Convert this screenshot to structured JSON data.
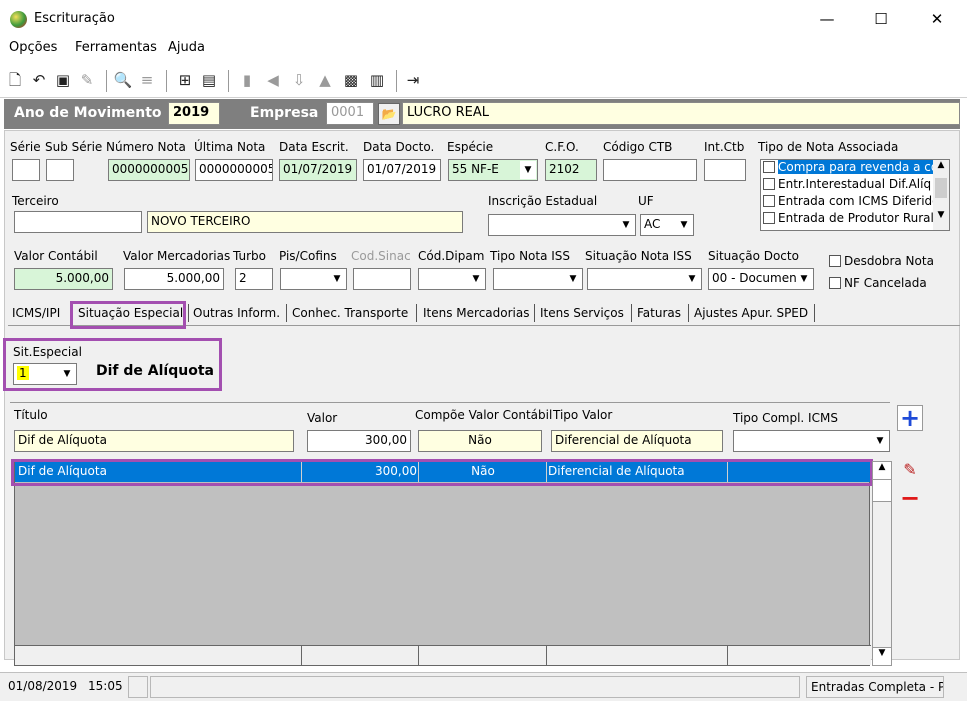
{
  "window": {
    "title": "Escrituração",
    "minimize": "—",
    "maximize": "☐",
    "close": "✕"
  },
  "menu": [
    "Opções",
    "Ferramentas",
    "Ajuda"
  ],
  "header": {
    "ano_label": "Ano de Movimento",
    "ano_value": "2019",
    "empresa_label": "Empresa",
    "empresa_code": "0001",
    "empresa_name": "LUCRO REAL"
  },
  "labels": {
    "serie": "Série",
    "sub_serie": "Sub Série",
    "numero_nota": "Número Nota",
    "ultima_nota": "Última Nota",
    "data_escrit": "Data Escrit.",
    "data_docto": "Data Docto.",
    "especie": "Espécie",
    "cfo": "C.F.O.",
    "codigo_ctb": "Código CTB",
    "int_ctb": "Int.Ctb",
    "tipo_nota_associada": "Tipo de Nota Associada",
    "terceiro": "Terceiro",
    "inscricao_estadual": "Inscrição Estadual",
    "uf": "UF",
    "valor_contabil": "Valor Contábil",
    "valor_mercadorias": "Valor Mercadorias",
    "turbo": "Turbo",
    "pis_cofins": "Pis/Cofins",
    "cod_sinac": "Cod.Sinac",
    "cod_dipam": "Cód.Dipam",
    "tipo_nota_iss": "Tipo Nota ISS",
    "situacao_nota_iss": "Situação Nota ISS",
    "situacao_docto": "Situação Docto",
    "desdobra_nota": "Desdobra Nota",
    "nf_cancelada": "NF Cancelada"
  },
  "values": {
    "serie": "",
    "sub_serie": "",
    "numero_nota": "0000000005",
    "ultima_nota": "0000000005",
    "data_escrit": "01/07/2019",
    "data_docto": "01/07/2019",
    "especie": "55 NF-E",
    "cfo": "2102",
    "codigo_ctb": "",
    "int_ctb": "",
    "terceiro_code": "",
    "terceiro_name": "NOVO TERCEIRO",
    "inscricao_estadual": "",
    "uf": "AC",
    "valor_contabil": "5.000,00",
    "valor_mercadorias": "5.000,00",
    "turbo": "2",
    "situacao_docto": "00 - Documen"
  },
  "tipo_nota_options": [
    {
      "label": "Compra para revenda a co",
      "selected": true
    },
    {
      "label": "Entr.Interestadual Dif.Alíq",
      "selected": false
    },
    {
      "label": "Entrada com ICMS Diferido",
      "selected": false
    },
    {
      "label": "Entrada de Produtor Rural",
      "selected": false
    }
  ],
  "tabs": [
    "ICMS/IPI",
    "Situação Especial",
    "Outras Inform.",
    "Conhec. Transporte",
    "Itens Mercadorias",
    "Itens Serviços",
    "Faturas",
    "Ajustes Apur. SPED"
  ],
  "active_tab": "Situação Especial",
  "sit_especial": {
    "label": "Sit.Especial",
    "value": "1",
    "description": "Dif de Alíquota"
  },
  "item_form": {
    "labels": {
      "titulo": "Título",
      "valor": "Valor",
      "compoe": "Compõe Valor Contábil",
      "tipo_valor": "Tipo Valor",
      "tipo_compl": "Tipo Compl. ICMS"
    },
    "values": {
      "titulo": "Dif de Alíquota",
      "valor": "300,00",
      "compoe": "Não",
      "tipo_valor": "Diferencial de Alíquota",
      "tipo_compl": ""
    }
  },
  "grid_rows": [
    {
      "titulo": "Dif de Alíquota",
      "valor": "300,00",
      "compoe": "Não",
      "tipo_valor": "Diferencial de Alíquota",
      "tipo_compl": ""
    }
  ],
  "status": {
    "date": "01/08/2019",
    "time": "15:05",
    "p3": "",
    "p4": "",
    "module": "Entradas Completa - P"
  },
  "colors": {
    "header_bg": "#7f7f7f",
    "highlight_border": "#a34fb0",
    "selection": "#0078d7",
    "green_field": "#d8f5d8",
    "yellow_field": "#ffffe1"
  }
}
